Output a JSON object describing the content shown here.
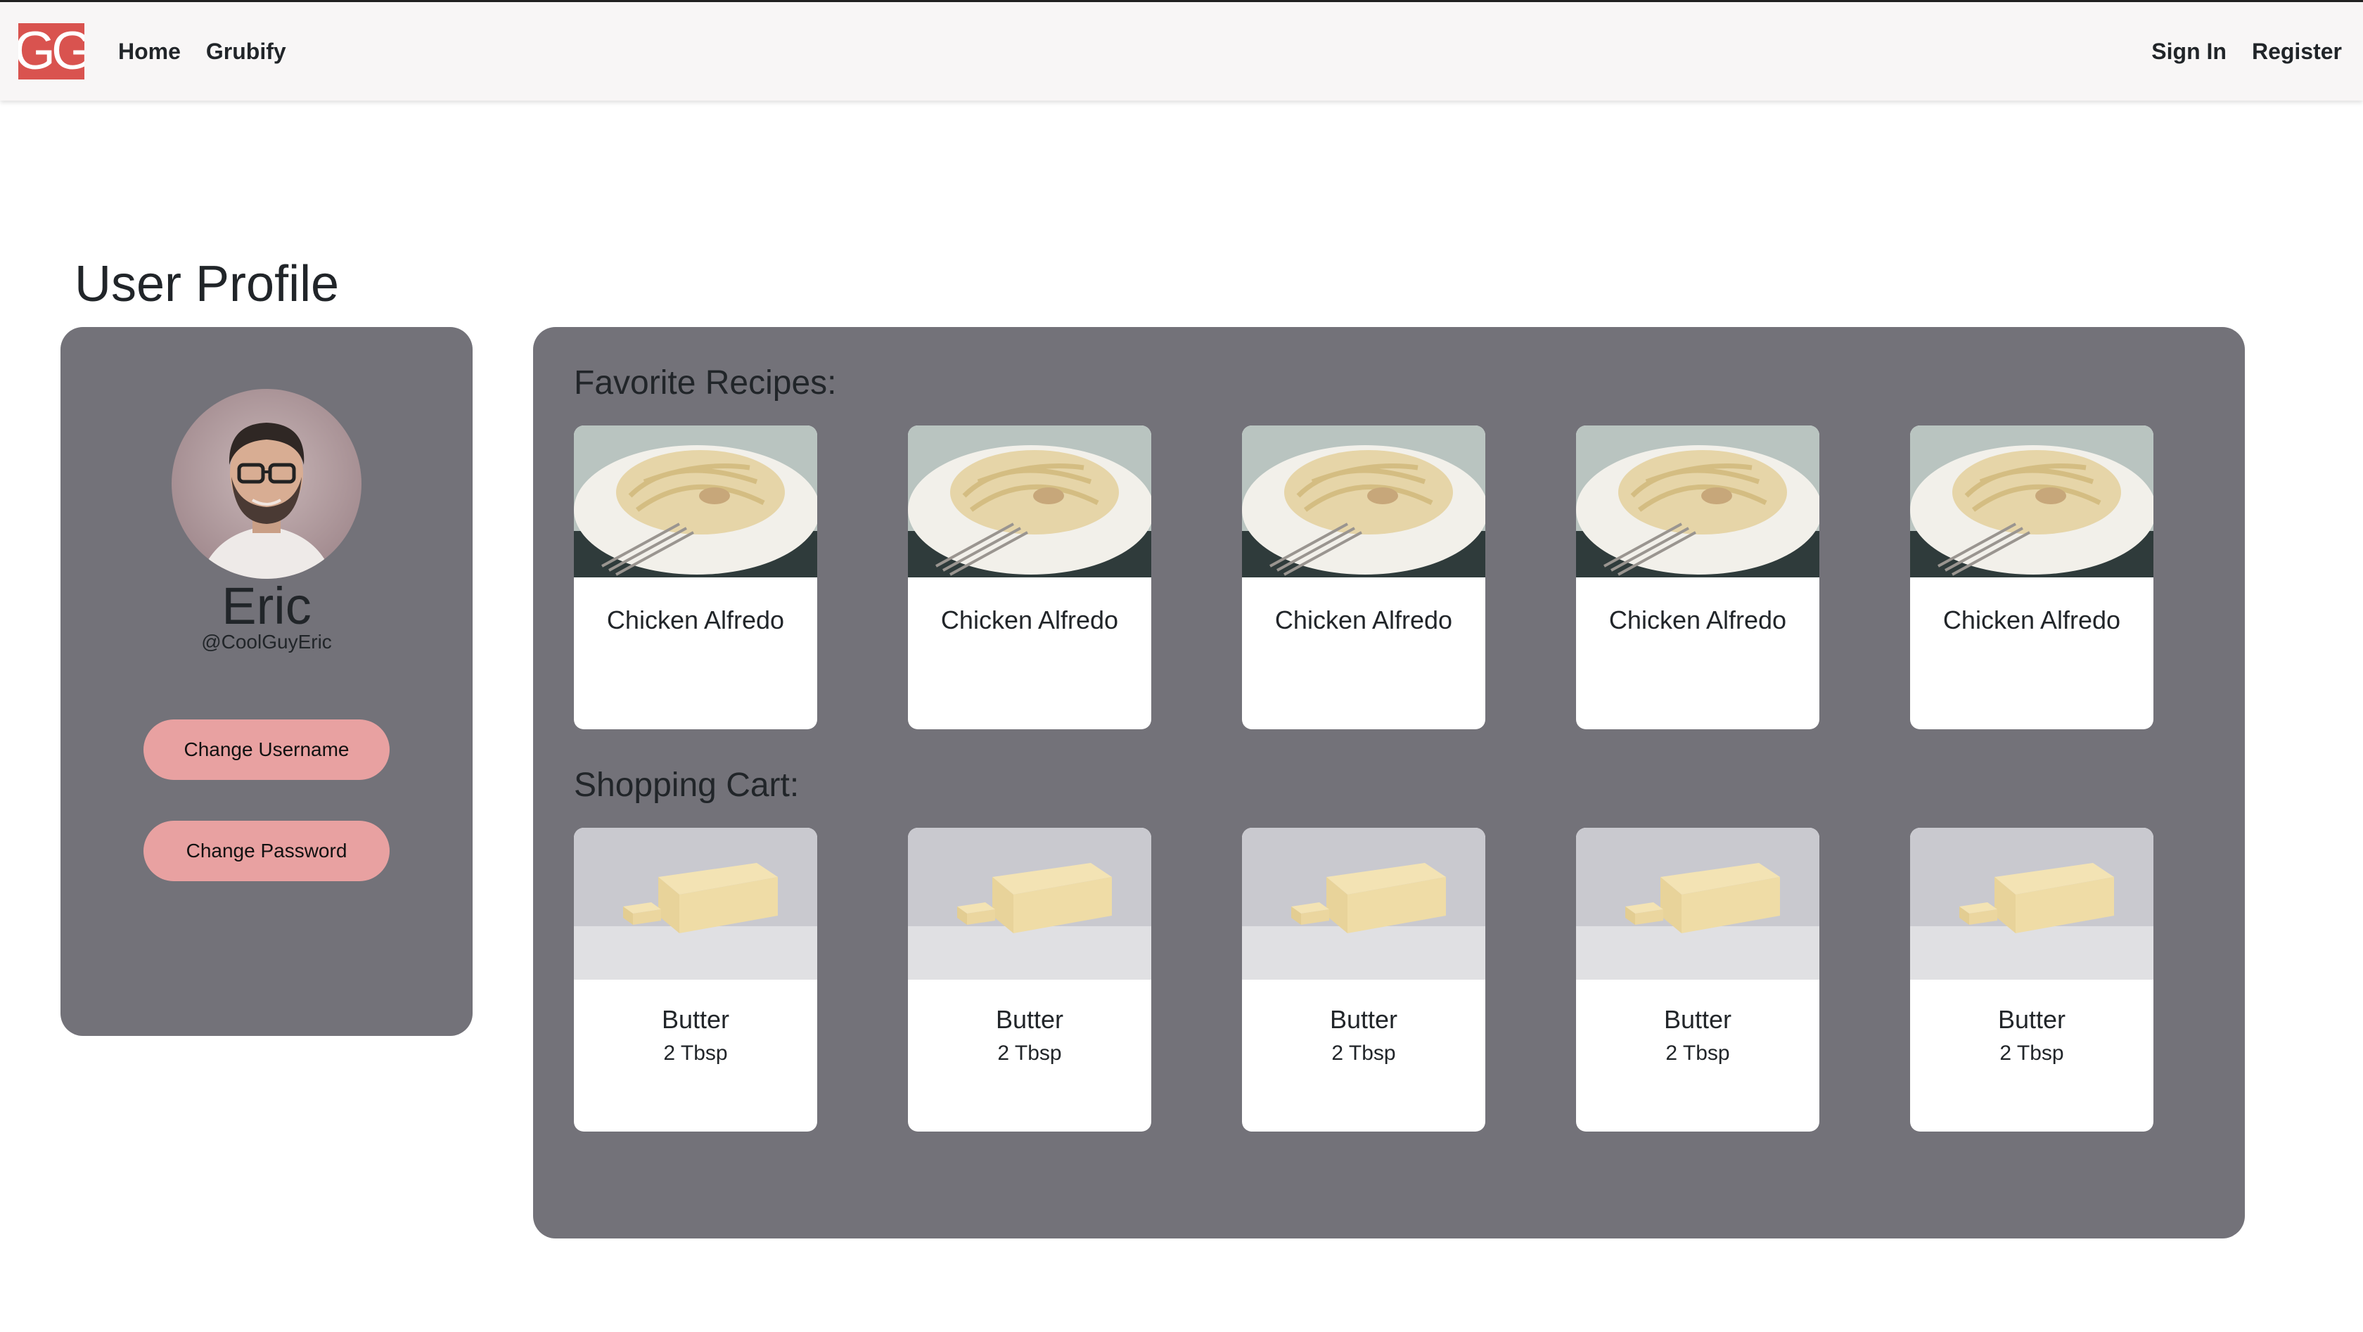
{
  "navbar": {
    "logo_text": "GG",
    "links_left": [
      "Home",
      "Grubify"
    ],
    "links_right": [
      "Sign In",
      "Register"
    ]
  },
  "page_title": "User Profile",
  "profile": {
    "name": "Eric",
    "handle": "@CoolGuyEric",
    "change_username_label": "Change Username",
    "change_password_label": "Change Password"
  },
  "favorites": {
    "title": "Favorite Recipes:",
    "items": [
      {
        "name": "Chicken Alfredo",
        "image": "chicken-alfredo-photo"
      },
      {
        "name": "Chicken Alfredo",
        "image": "chicken-alfredo-photo"
      },
      {
        "name": "Chicken Alfredo",
        "image": "chicken-alfredo-photo"
      },
      {
        "name": "Chicken Alfredo",
        "image": "chicken-alfredo-photo"
      },
      {
        "name": "Chicken Alfredo",
        "image": "chicken-alfredo-photo"
      }
    ]
  },
  "cart": {
    "title": "Shopping Cart:",
    "items": [
      {
        "name": "Butter",
        "quantity": "2 Tbsp",
        "image": "butter-photo"
      },
      {
        "name": "Butter",
        "quantity": "2 Tbsp",
        "image": "butter-photo"
      },
      {
        "name": "Butter",
        "quantity": "2 Tbsp",
        "image": "butter-photo"
      },
      {
        "name": "Butter",
        "quantity": "2 Tbsp",
        "image": "butter-photo"
      },
      {
        "name": "Butter",
        "quantity": "2 Tbsp",
        "image": "butter-photo"
      }
    ]
  },
  "colors": {
    "navbar_bg": "#f8f6f6",
    "logo_bg": "#d9534f",
    "panel_bg": "#737279",
    "button_bg": "#e8a1a1",
    "card_bg": "#ffffff"
  }
}
